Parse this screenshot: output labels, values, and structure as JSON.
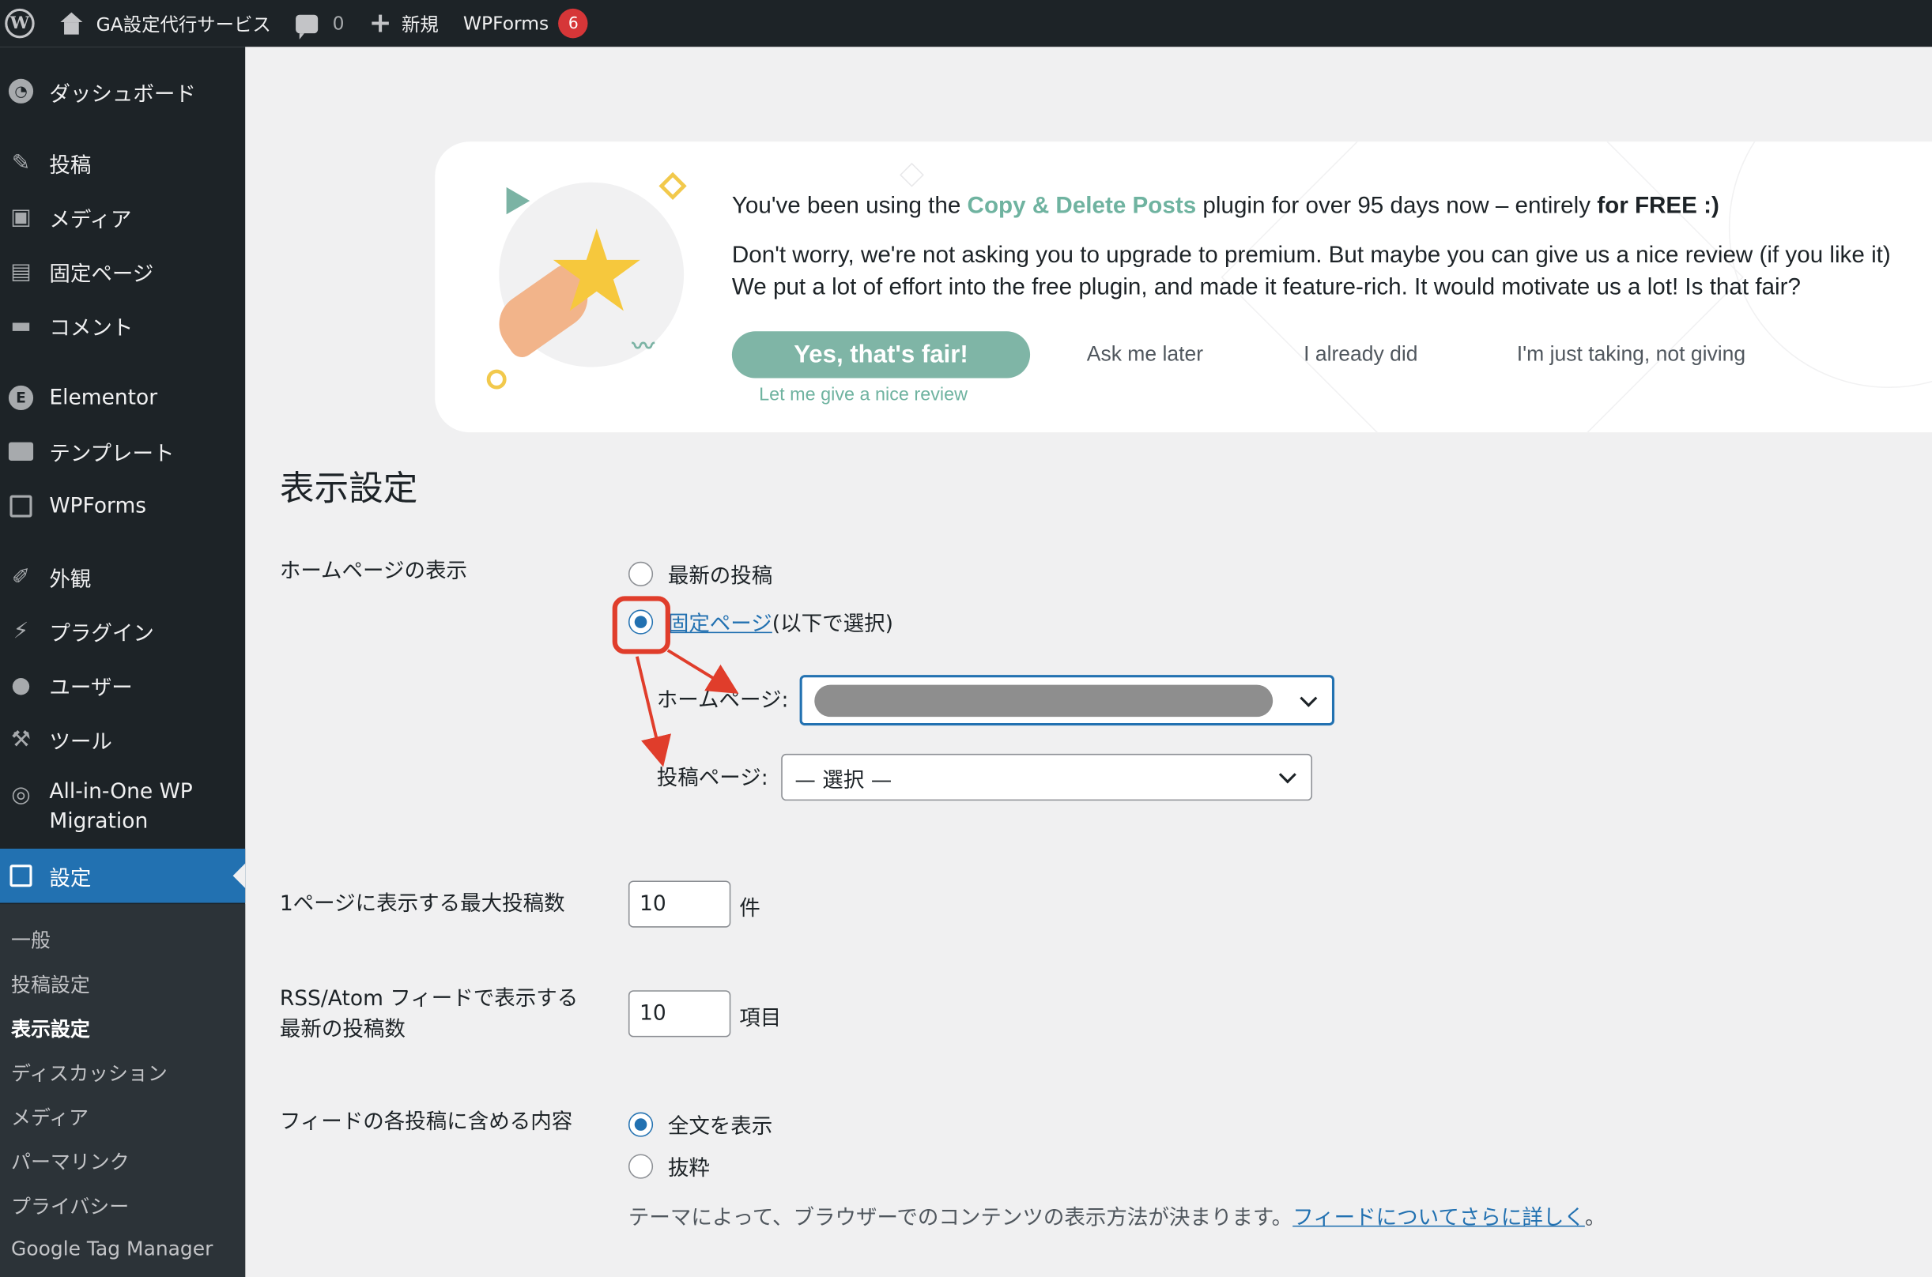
{
  "adminbar": {
    "site_name": "GA設定代行サービス",
    "comments_count": "0",
    "new_label": "新規",
    "wpforms_label": "WPForms",
    "wpforms_badge": "6"
  },
  "sidebar": {
    "items": [
      {
        "label": "ダッシュボード",
        "icon": "dashboard-icon"
      },
      {
        "label": "投稿",
        "icon": "pin-icon"
      },
      {
        "label": "メディア",
        "icon": "media-icon"
      },
      {
        "label": "固定ページ",
        "icon": "pages-icon"
      },
      {
        "label": "コメント",
        "icon": "comment-icon"
      },
      {
        "label": "Elementor",
        "icon": "elementor-icon"
      },
      {
        "label": "テンプレート",
        "icon": "folder-icon"
      },
      {
        "label": "WPForms",
        "icon": "form-icon"
      },
      {
        "label": "外観",
        "icon": "brush-icon"
      },
      {
        "label": "プラグイン",
        "icon": "plugin-icon"
      },
      {
        "label": "ユーザー",
        "icon": "user-icon"
      },
      {
        "label": "ツール",
        "icon": "wrench-icon"
      },
      {
        "label": "All-in-One WP",
        "label2": "Migration",
        "icon": "migration-icon"
      },
      {
        "label": "設定",
        "icon": "settings-icon",
        "active": true
      }
    ],
    "submenu": [
      "一般",
      "投稿設定",
      "表示設定",
      "ディスカッション",
      "メディア",
      "パーマリンク",
      "プライバシー",
      "Google Tag Manager"
    ],
    "current_submenu": "表示設定"
  },
  "notice": {
    "line1_pre": "You've been using the ",
    "line1_plugin": "Copy & Delete Posts",
    "line1_mid": " plugin for over 95 days now – entirely ",
    "line1_bold": "for FREE :)",
    "line2": "Don't worry, we're not asking you to upgrade to premium. But maybe you can give us a nice review (if you like it)",
    "line3": "We put a lot of effort into the free plugin, and made it feature-rich. It would motivate us a lot! Is that fair?",
    "yes_button": "Yes, that's fair!",
    "review_link": "Let me give a nice review",
    "ask_later": "Ask me later",
    "already_did": "I already did",
    "not_giving": "I'm just taking, not giving",
    "colors": {
      "accent": "#7fb5a6",
      "plugin_name": "#6fb3a0"
    }
  },
  "page": {
    "title": "表示設定",
    "homepage_display": {
      "label": "ホームページの表示",
      "option_latest": "最新の投稿",
      "option_static_link": "固定ページ",
      "option_static_suffix": " (以下で選択)",
      "selected": "static",
      "homepage_label": "ホームページ:",
      "homepage_value": "",
      "posts_page_label": "投稿ページ:",
      "posts_page_value": "— 選択 —"
    },
    "posts_per_page": {
      "label": "1ページに表示する最大投稿数",
      "value": "10",
      "unit": "件"
    },
    "rss_items": {
      "label_line1": "RSS/Atom フィードで表示する",
      "label_line2": "最新の投稿数",
      "value": "10",
      "unit": "項目"
    },
    "feed_content": {
      "label": "フィードの各投稿に含める内容",
      "option_full": "全文を表示",
      "option_excerpt": "抜粋",
      "selected": "full",
      "description_pre": "テーマによって、ブラウザーでのコンテンツの表示方法が決まります。",
      "description_link": "フィードについてさらに詳しく",
      "description_post": "。"
    }
  },
  "annotation_color": "#e03d2b"
}
